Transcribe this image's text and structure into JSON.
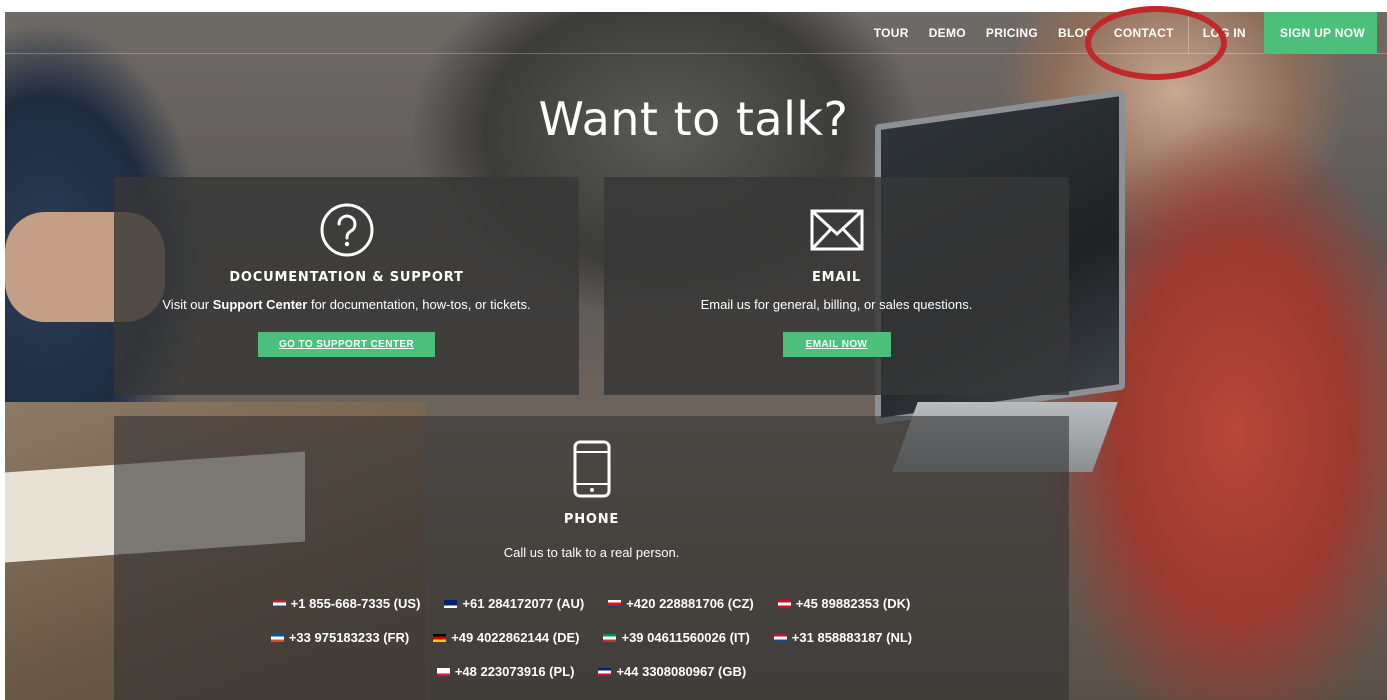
{
  "nav": {
    "items": [
      "TOUR",
      "DEMO",
      "PRICING",
      "BLOG",
      "CONTACT"
    ],
    "login": "LOG IN",
    "signup": "SIGN UP NOW"
  },
  "hero": {
    "title": "Want to talk?"
  },
  "docs": {
    "heading": "DOCUMENTATION & SUPPORT",
    "text_pre": "Visit our ",
    "text_bold": "Support Center",
    "text_post": " for documentation, how-tos, or tickets.",
    "button": "GO TO SUPPORT CENTER"
  },
  "email": {
    "heading": "EMAIL",
    "text": "Email us for general, billing, or sales questions.",
    "button": "EMAIL NOW"
  },
  "phone": {
    "heading": "PHONE",
    "text": "Call us to talk to a real person.",
    "rows": [
      [
        {
          "number": "+1 855-668-7335 (US)",
          "flag": [
            "#b22234",
            "#ffffff",
            "#3c3b6e"
          ]
        },
        {
          "number": "+61 284172077 (AU)",
          "flag": [
            "#012169",
            "#012169",
            "#ffffff"
          ]
        },
        {
          "number": "+420 228881706 (CZ)",
          "flag": [
            "#ffffff",
            "#d7141a",
            "#11457e"
          ]
        },
        {
          "number": "+45 89882353 (DK)",
          "flag": [
            "#c8102e",
            "#ffffff",
            "#c8102e"
          ]
        }
      ],
      [
        {
          "number": "+33 975183233 (FR)",
          "flag": [
            "#0055a4",
            "#ffffff",
            "#ef4135"
          ]
        },
        {
          "number": "+49 4022862144 (DE)",
          "flag": [
            "#000000",
            "#dd0000",
            "#ffce00"
          ]
        },
        {
          "number": "+39 04611560026 (IT)",
          "flag": [
            "#009246",
            "#ffffff",
            "#ce2b37"
          ]
        },
        {
          "number": "+31 858883187 (NL)",
          "flag": [
            "#ae1c28",
            "#ffffff",
            "#21468b"
          ]
        }
      ],
      [
        {
          "number": "+48 223073916 (PL)",
          "flag": [
            "#ffffff",
            "#ffffff",
            "#dc143c"
          ]
        },
        {
          "number": "+44 3308080967 (GB)",
          "flag": [
            "#012169",
            "#ffffff",
            "#c8102e"
          ]
        }
      ]
    ]
  },
  "colors": {
    "accent": "#4cbf7a",
    "annotation": "#c0282a"
  }
}
